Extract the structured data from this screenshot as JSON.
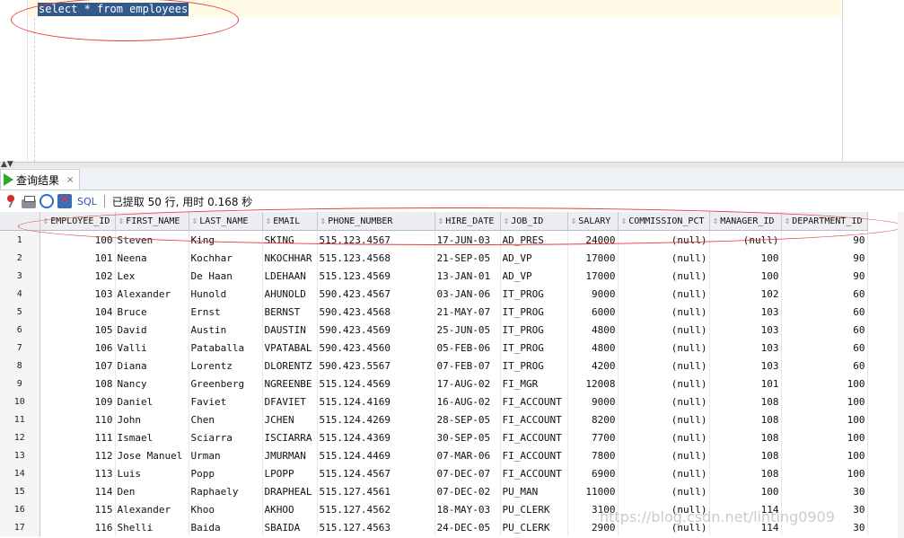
{
  "editor": {
    "query": "select * from employees"
  },
  "results_tab": {
    "label": "查询结果",
    "close": "×"
  },
  "toolbar": {
    "sql_label": "SQL",
    "status": "已提取 50 行, 用时 0.168 秒"
  },
  "columns": [
    "EMPLOYEE_ID",
    "FIRST_NAME",
    "LAST_NAME",
    "EMAIL",
    "PHONE_NUMBER",
    "HIRE_DATE",
    "JOB_ID",
    "SALARY",
    "COMMISSION_PCT",
    "MANAGER_ID",
    "DEPARTMENT_ID"
  ],
  "rows": [
    [
      "1",
      "100",
      "Steven",
      "King",
      "SKING",
      "515.123.4567",
      "17-JUN-03",
      "AD_PRES",
      "24000",
      "(null)",
      "(null)",
      "90"
    ],
    [
      "2",
      "101",
      "Neena",
      "Kochhar",
      "NKOCHHAR",
      "515.123.4568",
      "21-SEP-05",
      "AD_VP",
      "17000",
      "(null)",
      "100",
      "90"
    ],
    [
      "3",
      "102",
      "Lex",
      "De Haan",
      "LDEHAAN",
      "515.123.4569",
      "13-JAN-01",
      "AD_VP",
      "17000",
      "(null)",
      "100",
      "90"
    ],
    [
      "4",
      "103",
      "Alexander",
      "Hunold",
      "AHUNOLD",
      "590.423.4567",
      "03-JAN-06",
      "IT_PROG",
      "9000",
      "(null)",
      "102",
      "60"
    ],
    [
      "5",
      "104",
      "Bruce",
      "Ernst",
      "BERNST",
      "590.423.4568",
      "21-MAY-07",
      "IT_PROG",
      "6000",
      "(null)",
      "103",
      "60"
    ],
    [
      "6",
      "105",
      "David",
      "Austin",
      "DAUSTIN",
      "590.423.4569",
      "25-JUN-05",
      "IT_PROG",
      "4800",
      "(null)",
      "103",
      "60"
    ],
    [
      "7",
      "106",
      "Valli",
      "Pataballa",
      "VPATABAL",
      "590.423.4560",
      "05-FEB-06",
      "IT_PROG",
      "4800",
      "(null)",
      "103",
      "60"
    ],
    [
      "8",
      "107",
      "Diana",
      "Lorentz",
      "DLORENTZ",
      "590.423.5567",
      "07-FEB-07",
      "IT_PROG",
      "4200",
      "(null)",
      "103",
      "60"
    ],
    [
      "9",
      "108",
      "Nancy",
      "Greenberg",
      "NGREENBE",
      "515.124.4569",
      "17-AUG-02",
      "FI_MGR",
      "12008",
      "(null)",
      "101",
      "100"
    ],
    [
      "10",
      "109",
      "Daniel",
      "Faviet",
      "DFAVIET",
      "515.124.4169",
      "16-AUG-02",
      "FI_ACCOUNT",
      "9000",
      "(null)",
      "108",
      "100"
    ],
    [
      "11",
      "110",
      "John",
      "Chen",
      "JCHEN",
      "515.124.4269",
      "28-SEP-05",
      "FI_ACCOUNT",
      "8200",
      "(null)",
      "108",
      "100"
    ],
    [
      "12",
      "111",
      "Ismael",
      "Sciarra",
      "ISCIARRA",
      "515.124.4369",
      "30-SEP-05",
      "FI_ACCOUNT",
      "7700",
      "(null)",
      "108",
      "100"
    ],
    [
      "13",
      "112",
      "Jose Manuel",
      "Urman",
      "JMURMAN",
      "515.124.4469",
      "07-MAR-06",
      "FI_ACCOUNT",
      "7800",
      "(null)",
      "108",
      "100"
    ],
    [
      "14",
      "113",
      "Luis",
      "Popp",
      "LPOPP",
      "515.124.4567",
      "07-DEC-07",
      "FI_ACCOUNT",
      "6900",
      "(null)",
      "108",
      "100"
    ],
    [
      "15",
      "114",
      "Den",
      "Raphaely",
      "DRAPHEAL",
      "515.127.4561",
      "07-DEC-02",
      "PU_MAN",
      "11000",
      "(null)",
      "100",
      "30"
    ],
    [
      "16",
      "115",
      "Alexander",
      "Khoo",
      "AKHOO",
      "515.127.4562",
      "18-MAY-03",
      "PU_CLERK",
      "3100",
      "(null)",
      "114",
      "30"
    ],
    [
      "17",
      "116",
      "Shelli",
      "Baida",
      "SBAIDA",
      "515.127.4563",
      "24-DEC-05",
      "PU_CLERK",
      "2900",
      "(null)",
      "114",
      "30"
    ]
  ],
  "watermark": "https://blog.csdn.net/linting0909",
  "colors": {
    "highlight": "#31598c",
    "annotation": "#e83a3a",
    "run": "#2fa82f"
  }
}
